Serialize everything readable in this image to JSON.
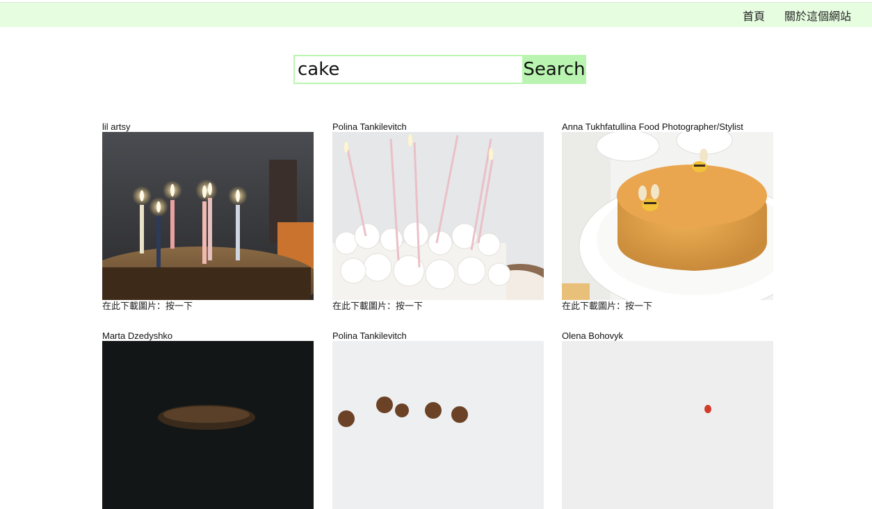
{
  "nav": {
    "home": "首頁",
    "about": "關於這個網站"
  },
  "search": {
    "value": "cake",
    "button_label": "Search"
  },
  "results": [
    {
      "author": "lil artsy",
      "download": "在此下載圖片：按一下"
    },
    {
      "author": "Polina Tankilevitch",
      "download": "在此下載圖片：按一下"
    },
    {
      "author": "Anna Tukhfatullina Food Photographer/Stylist",
      "download": "在此下載圖片：按一下"
    },
    {
      "author": "Marta Dzedyshko"
    },
    {
      "author": "Polina Tankilevitch"
    },
    {
      "author": "Olena Bohovyk"
    }
  ],
  "colors": {
    "header_bg": "#e6fde0",
    "accent": "#b9f5b0"
  }
}
